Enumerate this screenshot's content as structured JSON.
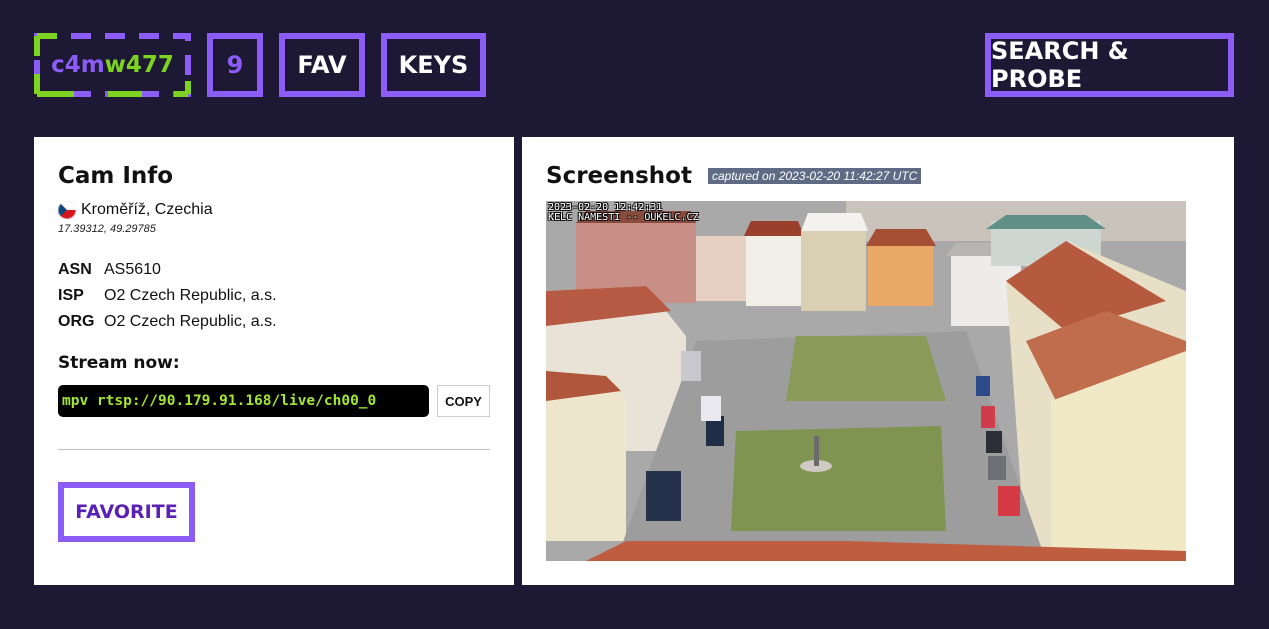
{
  "nav": {
    "logo_part1": "c4m",
    "logo_part2": "w477",
    "count": "9",
    "fav": "FAV",
    "keys": "KEYS",
    "search": "SEARCH & PROBE"
  },
  "cam_info": {
    "title": "Cam Info",
    "flag_icon": "czech-flag-icon",
    "location": "Kroměříž, Czechia",
    "coords": "17.39312, 49.29785",
    "fields": [
      {
        "key": "ASN",
        "value": "AS5610"
      },
      {
        "key": "ISP",
        "value": "O2 Czech Republic, a.s."
      },
      {
        "key": "ORG",
        "value": "O2 Czech Republic, a.s."
      }
    ],
    "stream_heading": "Stream now:",
    "stream_cmd": "mpv rtsp://90.179.91.168/live/ch00_0",
    "copy_label": "COPY",
    "favorite_label": "FAVORITE"
  },
  "screenshot": {
    "title": "Screenshot",
    "captured": "captured on 2023-02-20 11:42:27 UTC",
    "osd_line1": "2023-02-20 12:42:31",
    "osd_line2": "KELC NAMESTI -- OUKELC.CZ"
  },
  "colors": {
    "background": "#1d1833",
    "accent": "#8b5cf6",
    "logo_green": "#7ed321",
    "cmd_text": "#a3e635"
  }
}
